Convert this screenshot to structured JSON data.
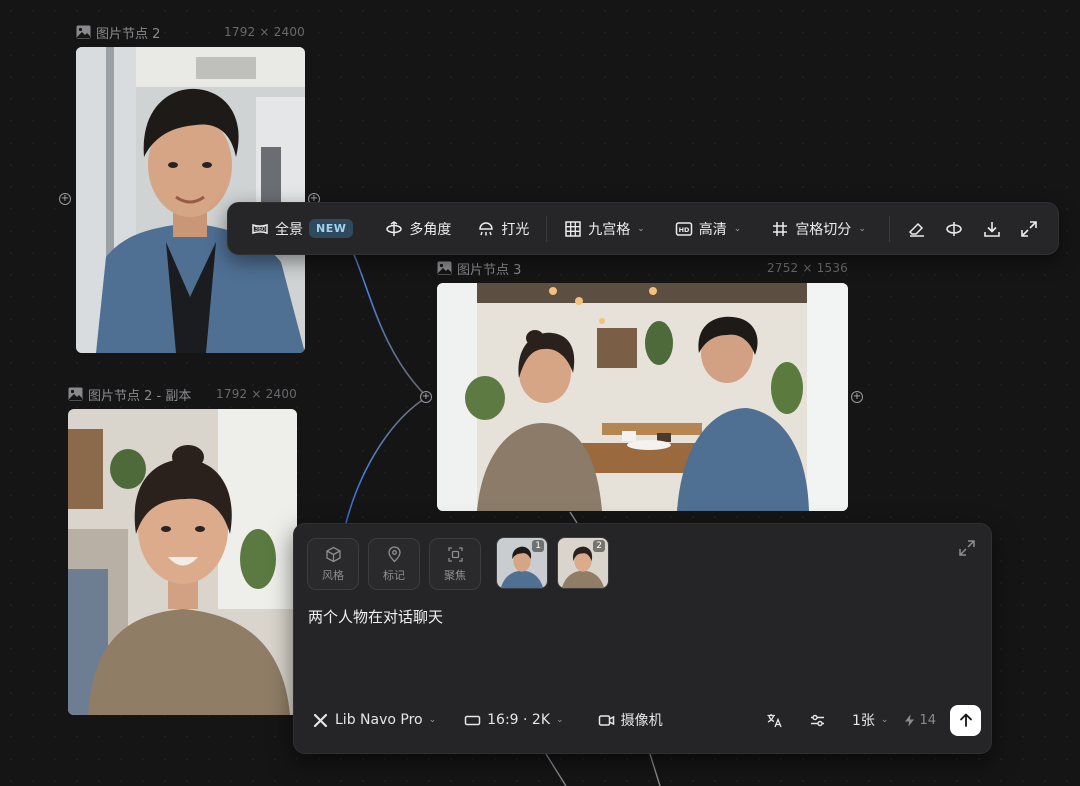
{
  "nodes": [
    {
      "title": "图片节点 2",
      "dims": "1792 × 2400"
    },
    {
      "title": "图片节点 2 - 副本",
      "dims": "1792 × 2400"
    },
    {
      "title": "图片节点 3",
      "dims": "2752 × 1536"
    }
  ],
  "toolbar": {
    "panorama_label": "全景",
    "new_badge": "NEW",
    "multi_angle_label": "多角度",
    "lighting_label": "打光",
    "nine_grid_label": "九宫格",
    "hd_label": "高清",
    "grid_split_label": "宫格切分"
  },
  "panel": {
    "chips": [
      "风格",
      "标记",
      "聚焦"
    ],
    "refs": [
      "1",
      "2"
    ],
    "prompt": "两个人物在对话聊天",
    "model_label": "Lib Navo Pro",
    "ratio_label": "16:9 · 2K",
    "camera_label": "摄像机",
    "count_label": "1张",
    "credits": "14"
  },
  "colors": {
    "background": "#151516",
    "panel": "#252527",
    "toolbar": "#262628",
    "new_badge_bg": "#2f4a5c",
    "wire_glow": "#4a7fd8",
    "send_button": "#ffffff"
  }
}
